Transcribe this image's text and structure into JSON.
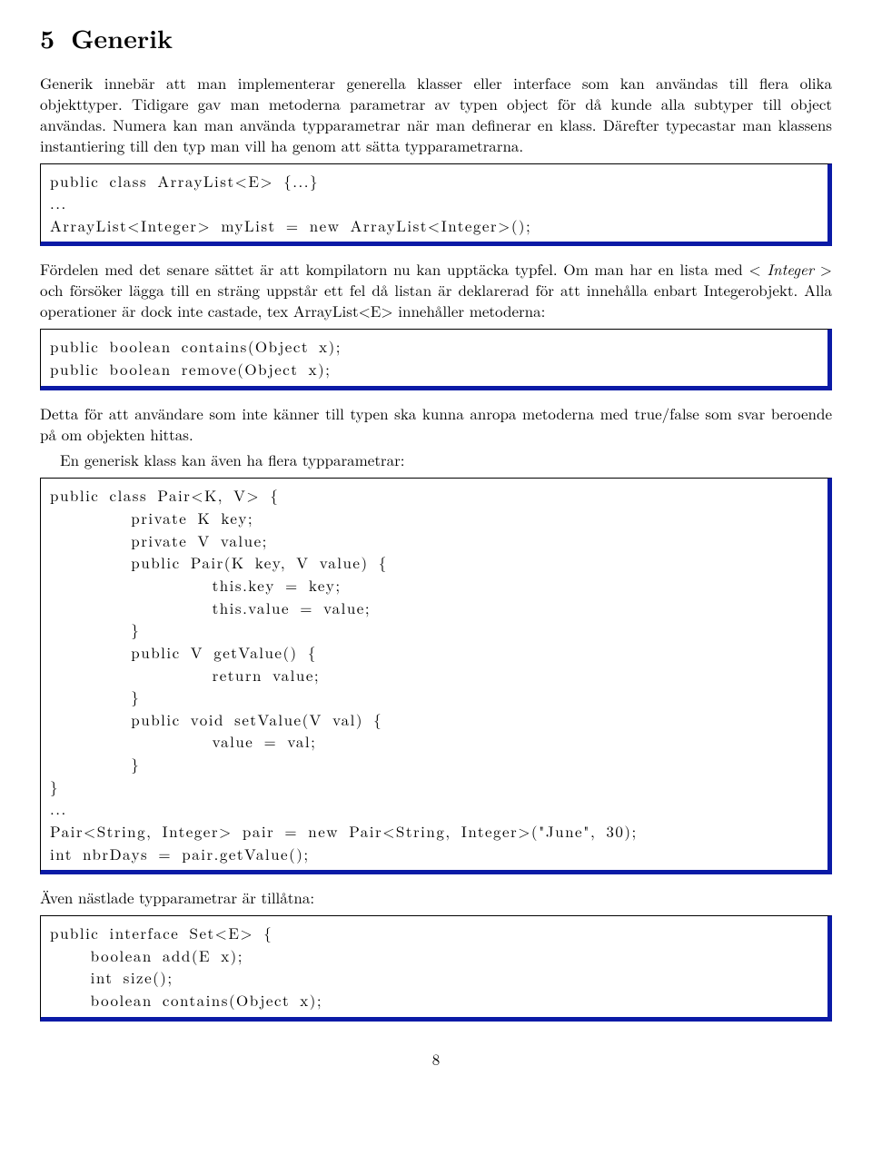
{
  "section": {
    "number": "5",
    "title": "Generik"
  },
  "para1": "Generik innebär att man implementerar generella klasser eller interface som kan användas till flera olika objekttyper. Tidigare gav man metoderna parametrar av typen object för då kunde alla subtyper till object användas. Numera kan man använda typparametrar när man definerar en klass. Därefter typecastar man klassens instantiering till den typ man vill ha genom att sätta typparametrarna.",
  "code1": "public class ArrayList<E> {...}\n...\nArrayList<Integer> myList = new ArrayList<Integer>();",
  "para2_a": "Fördelen med det senare sättet är att kompilatorn nu kan upptäcka typfel. Om man har en lista med < ",
  "para2_ital": "Integer",
  "para2_b": " > och försöker lägga till en sträng uppstår ett fel då listan är deklarerad för att innehålla enbart Integerobjekt. Alla operationer är dock inte castade, tex ArrayList<E> innehåller metoderna:",
  "code2": "public boolean contains(Object x);\npublic boolean remove(Object x);",
  "para3": "Detta för att användare som inte känner till typen ska kunna anropa metoderna med true/false som svar beroende på om objekten hittas.",
  "para4": "En generisk klass kan även ha flera typparametrar:",
  "code3": "public class Pair<K, V> {\n        private K key;\n        private V value;\n        public Pair(K key, V value) {\n                this.key = key;\n                this.value = value;\n        }\n        public V getValue() {\n                return value;\n        }\n        public void setValue(V val) {\n                value = val;\n        }\n}\n...\nPair<String, Integer> pair = new Pair<String, Integer>(\"June\", 30);\nint nbrDays = pair.getValue();",
  "para5": "Även nästlade typparametrar är tillåtna:",
  "code4": "public interface Set<E> {\n    boolean add(E x);\n    int size();\n    boolean contains(Object x);",
  "pageNumber": "8"
}
